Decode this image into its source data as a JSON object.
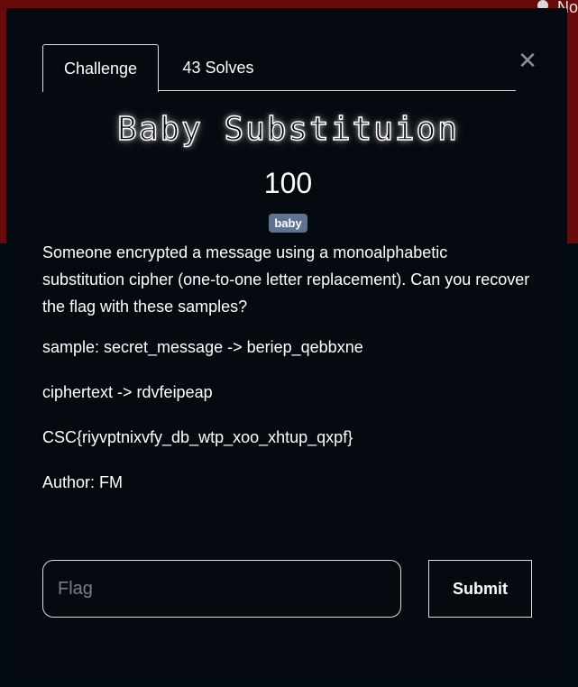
{
  "background": {
    "corner_text": "No"
  },
  "modal": {
    "close_glyph": "✕",
    "tabs": [
      {
        "label": "Challenge",
        "active": true
      },
      {
        "label": "43 Solves",
        "active": false
      }
    ],
    "title": "Baby Substituion",
    "points": "100",
    "tag": "baby",
    "description": "Someone encrypted a message using a monoalphabetic substitution cipher (one-to-one letter replacement). Can you recover the flag with these samples?",
    "lines": [
      "sample: secret_message -> beriep_qebbxne",
      "ciphertext -> rdvfeipeap",
      "CSC{riyvptnixvfy_db_wtp_xoo_xhtup_qxpf}",
      "Author: FM"
    ],
    "flag_input": {
      "placeholder": "Flag",
      "value": ""
    },
    "submit_label": "Submit"
  },
  "colors": {
    "backdrop_top": "#6b0a0a",
    "backdrop_bottom": "#020a12",
    "modal_bg": "#050a10",
    "tag_bg": "#5f7390",
    "border": "#dcdcdc"
  }
}
